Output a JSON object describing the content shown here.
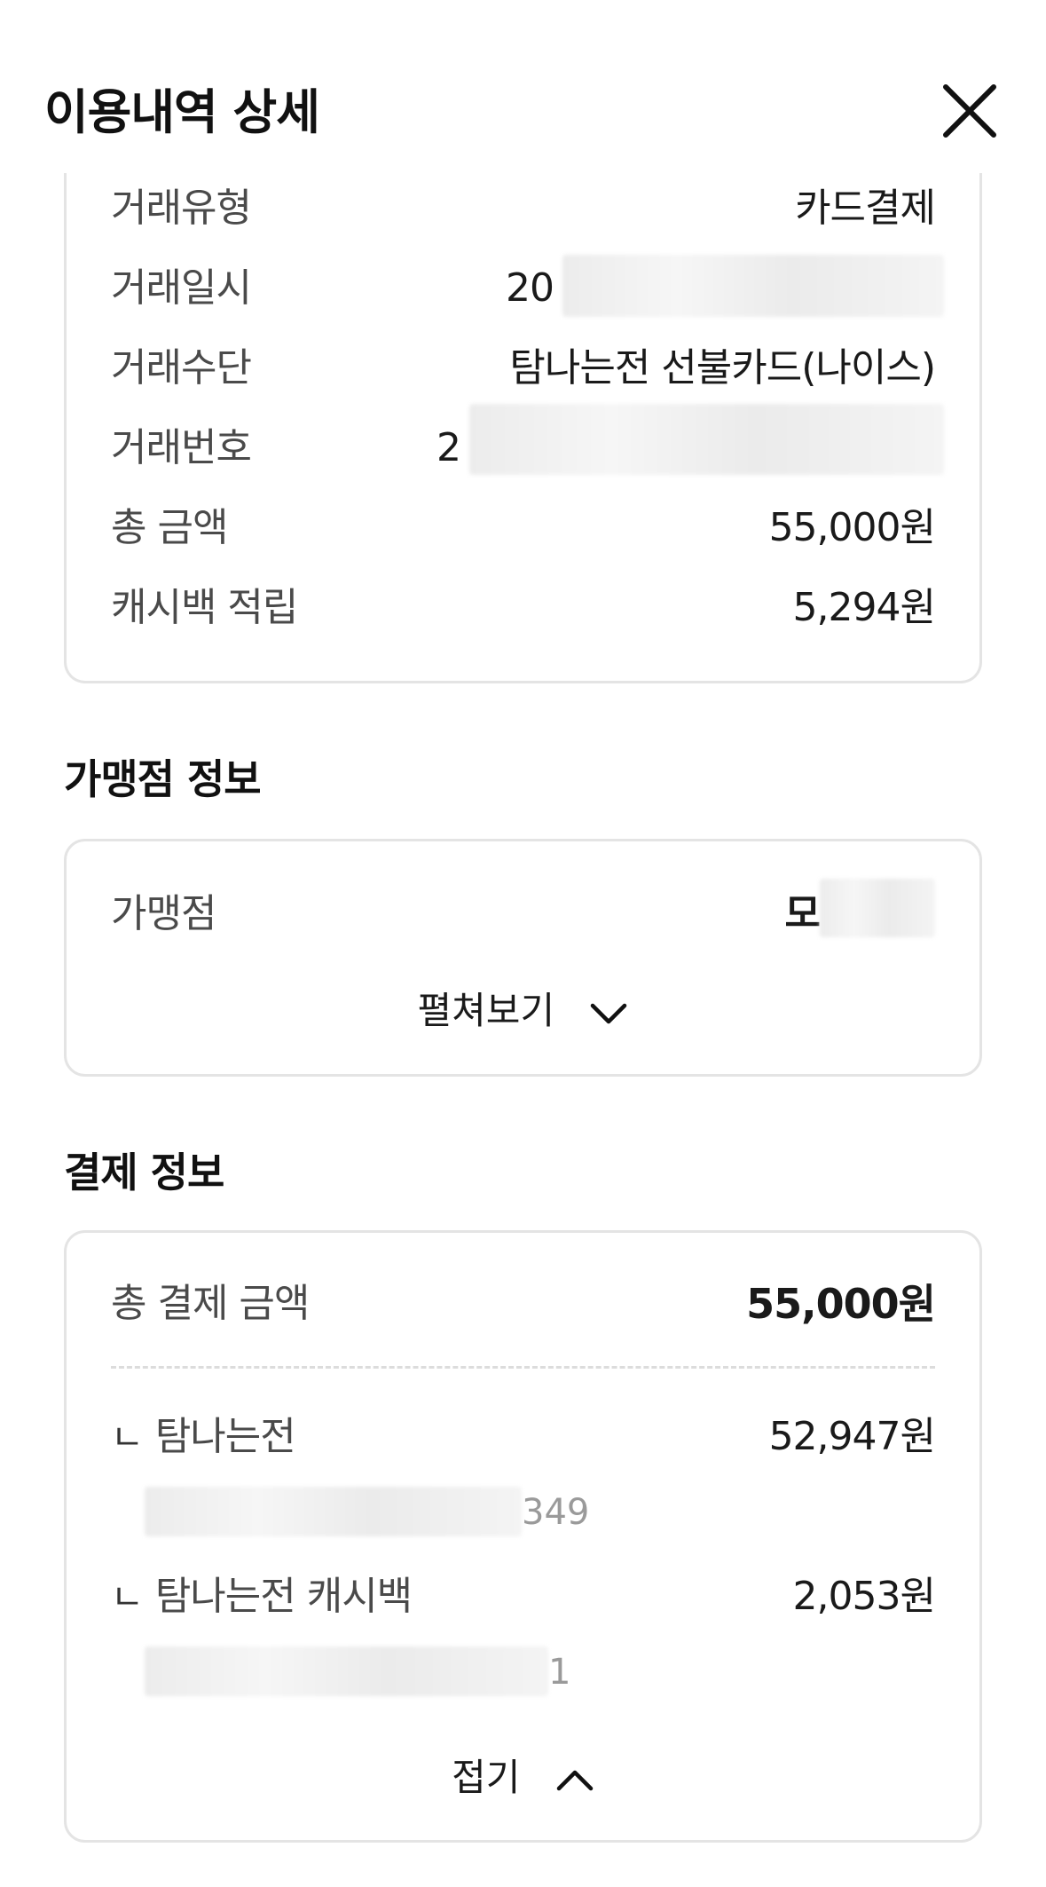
{
  "header": {
    "title": "이용내역 상세",
    "close_icon": "close-icon"
  },
  "transaction": {
    "rows": [
      {
        "label": "거래유형",
        "value": "카드결제"
      },
      {
        "label": "거래일시",
        "value": "20"
      },
      {
        "label": "거래수단",
        "value": "탐나는전 선불카드(나이스)"
      },
      {
        "label": "거래번호",
        "value": "2"
      },
      {
        "label": "총 금액",
        "value": "55,000원"
      },
      {
        "label": "캐시백 적립",
        "value": "5,294원"
      }
    ]
  },
  "merchant": {
    "section_title": "가맹점 정보",
    "label": "가맹점",
    "value": "모",
    "expand_label": "펼쳐보기"
  },
  "payment": {
    "section_title": "결제 정보",
    "total_label": "총 결제 금액",
    "total_value": "55,000원",
    "items": [
      {
        "corner": "ㄴ",
        "label": "탐나는전",
        "value": "52,947원",
        "masked_suffix": "349"
      },
      {
        "corner": "ㄴ",
        "label": "탐나는전 캐시백",
        "value": "2,053원",
        "masked_suffix": "1"
      }
    ],
    "collapse_label": "접기"
  }
}
